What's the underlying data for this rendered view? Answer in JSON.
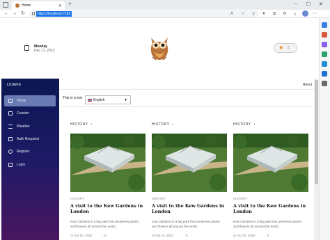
{
  "browser": {
    "tab_title": "Home",
    "url": "https://localhost:7183",
    "new_tab": "+"
  },
  "header": {
    "day": "Monday",
    "date": "Dec 11, 2023"
  },
  "sidebar": {
    "brand": "LIUWeb",
    "items": [
      {
        "label": "Home",
        "icon": "home-icon",
        "active": true
      },
      {
        "label": "Counter",
        "icon": "plus-icon"
      },
      {
        "label": "Weather",
        "icon": "list-icon"
      },
      {
        "label": "Auth Required",
        "icon": "lock-icon"
      },
      {
        "label": "Register",
        "icon": "user-icon"
      },
      {
        "label": "Login",
        "icon": "login-icon"
      }
    ]
  },
  "topnav": {
    "about": "About"
  },
  "content": {
    "test_text": "This is a test",
    "language": "English",
    "cards": [
      {
        "section": "HISTORY",
        "category": "HISTORY",
        "title": "A visit to the Kew Gardens in London",
        "description": "Kew Gardens is a big park that preserves plants and flowers all around the world.",
        "date": "Oct 10, 2023",
        "count": "0"
      },
      {
        "section": "HISTORY",
        "category": "HISTORY",
        "title": "A visit to the Kew Gardens in London",
        "description": "Kew Gardens is a big park that preserves plants and flowers all around the world.",
        "date": "Oct 10, 2023",
        "count": "0"
      },
      {
        "section": "HISTORY",
        "category": "HISTORY",
        "title": "A visit to the Kew Gardens in London",
        "description": "Kew Gardens is a big park that preserves plants and flowers all around the world.",
        "date": "Oct 10, 2023",
        "count": "0"
      }
    ]
  },
  "colors": {
    "sidebar_top": "#0b1752",
    "sidebar_bottom": "#4a1660",
    "active_item": "#6a7bb3",
    "url_highlight": "#1a73e8"
  }
}
